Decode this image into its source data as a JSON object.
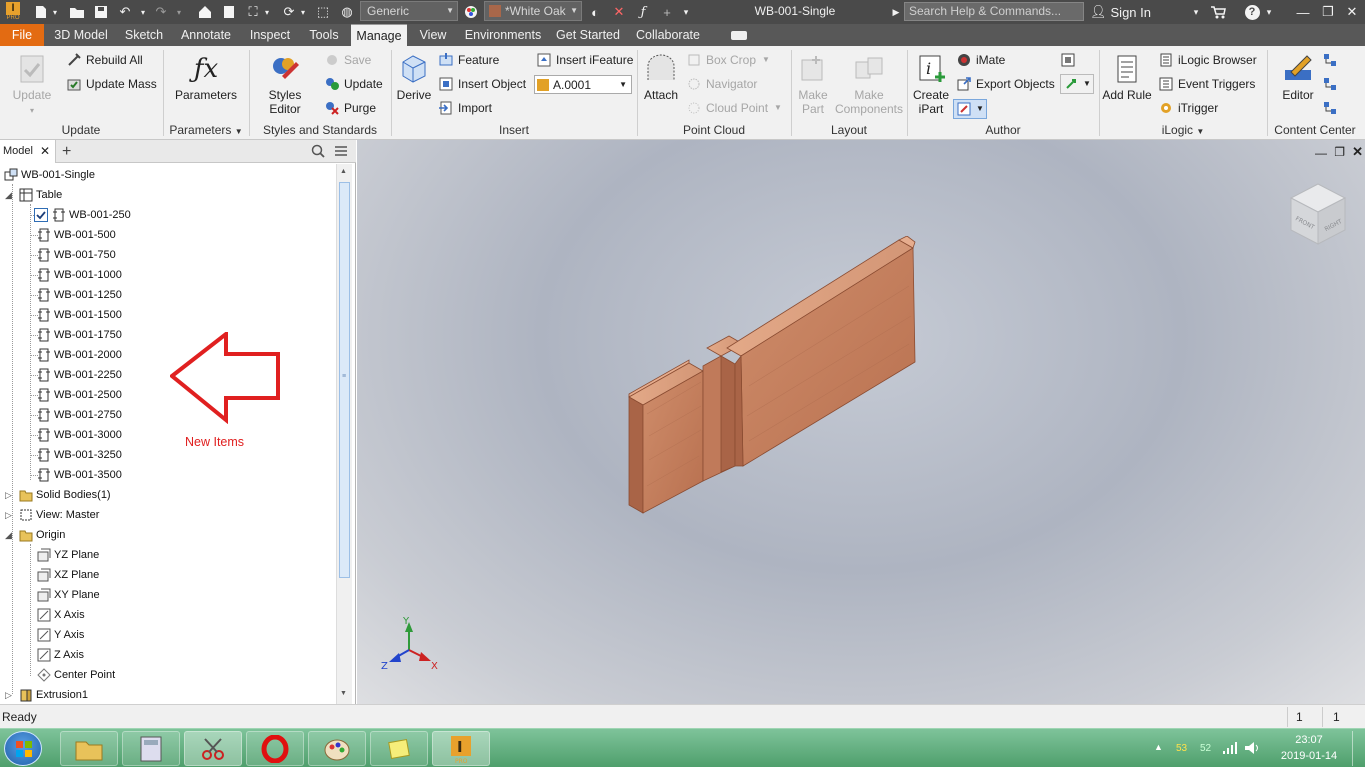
{
  "titlebar": {
    "title": "WB-001-Single",
    "material_combo": "Generic",
    "appearance_combo": "*White Oak",
    "search_placeholder": "Search Help & Commands...",
    "sign_in": "Sign In",
    "app_badge": "PRO"
  },
  "tabs": [
    "File",
    "3D Model",
    "Sketch",
    "Annotate",
    "Inspect",
    "Tools",
    "Manage",
    "View",
    "Environments",
    "Get Started",
    "Collaborate"
  ],
  "active_tab": "Manage",
  "ribbon": {
    "update": {
      "big_label": "Update",
      "rebuild_all": "Rebuild All",
      "update_mass": "Update Mass",
      "panel": "Update"
    },
    "parameters": {
      "big_label": "Parameters",
      "panel": "Parameters"
    },
    "styles": {
      "big_label": "Styles Editor",
      "save": "Save",
      "update": "Update",
      "purge": "Purge",
      "panel": "Styles and Standards"
    },
    "insert": {
      "derive": "Derive",
      "feature": "Feature",
      "insert_object": "Insert Object",
      "import": "Import",
      "insert_ifeature": "Insert iFeature",
      "combo_value": "A.0001",
      "panel": "Insert"
    },
    "point_cloud": {
      "attach": "Attach",
      "box_crop": "Box Crop",
      "navigator": "Navigator",
      "cloud_point": "Cloud Point",
      "panel": "Point Cloud"
    },
    "layout": {
      "make_part": [
        "Make",
        "Part"
      ],
      "make_components": [
        "Make",
        "Components"
      ],
      "panel": "Layout"
    },
    "author": {
      "create_ipart": [
        "Create",
        "iPart"
      ],
      "imate": "iMate",
      "export_objects": "Export Objects",
      "panel": "Author"
    },
    "ilogic": {
      "add_rule": "Add Rule",
      "ilogic_browser": "iLogic Browser",
      "event_triggers": "Event Triggers",
      "itrigger": "iTrigger",
      "panel": "iLogic"
    },
    "content_center": {
      "editor": "Editor",
      "panel": "Content Center"
    }
  },
  "model_panel": {
    "tab_label": "Model",
    "root": "WB-001-Single",
    "table": "Table",
    "members": [
      "WB-001-250",
      "WB-001-500",
      "WB-001-750",
      "WB-001-1000",
      "WB-001-1250",
      "WB-001-1500",
      "WB-001-1750",
      "WB-001-2000",
      "WB-001-2250",
      "WB-001-2500",
      "WB-001-2750",
      "WB-001-3000",
      "WB-001-3250",
      "WB-001-3500"
    ],
    "solid_bodies": "Solid Bodies(1)",
    "view_master": "View: Master",
    "origin": "Origin",
    "origin_items": [
      "YZ Plane",
      "XZ Plane",
      "XY Plane",
      "X Axis",
      "Y Axis",
      "Z Axis",
      "Center Point"
    ],
    "extrusion": "Extrusion1"
  },
  "annotation": {
    "text": "New Items",
    "color": "#e02020"
  },
  "viewcube": {
    "front": "FRONT",
    "right": "RIGHT"
  },
  "triad": {
    "x": "X",
    "y": "Y",
    "z": "Z"
  },
  "status": {
    "text": "Ready",
    "count1": "1",
    "count2": "1"
  },
  "taskbar": {
    "tray_num1": "53",
    "tray_num2": "52",
    "time": "23:07",
    "date": "2019-01-14"
  },
  "colors": {
    "file_tab": "#e36b12",
    "wood": "#c88664",
    "accent_blue": "#2f6db5"
  }
}
